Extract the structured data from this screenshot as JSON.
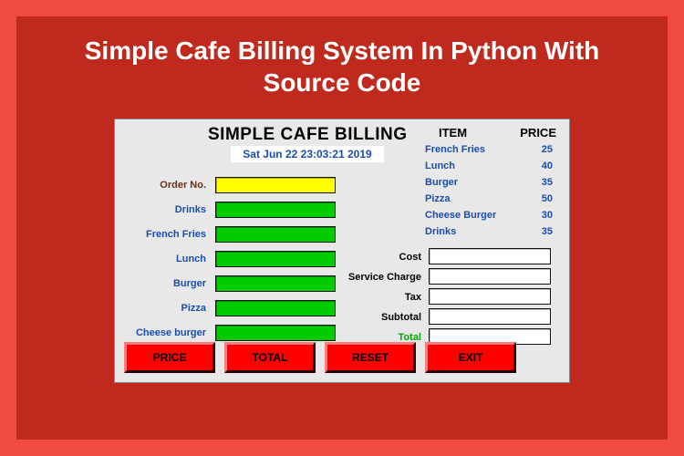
{
  "headline": "Simple Cafe Billing System In Python With Source Code",
  "app": {
    "title": "SIMPLE CAFE BILLING",
    "timestamp": "Sat Jun 22 23:03:21 2019",
    "price_table": {
      "header_item": "ITEM",
      "header_price": "PRICE",
      "rows": [
        {
          "name": "French Fries",
          "price": "25"
        },
        {
          "name": "Lunch",
          "price": "40"
        },
        {
          "name": "Burger",
          "price": "35"
        },
        {
          "name": "Pizza",
          "price": "50"
        },
        {
          "name": "Cheese Burger",
          "price": "30"
        },
        {
          "name": "Drinks",
          "price": "35"
        }
      ]
    },
    "inputs": {
      "order_no_label": "Order No.",
      "drinks_label": "Drinks",
      "french_fries_label": "French Fries",
      "lunch_label": "Lunch",
      "burger_label": "Burger",
      "pizza_label": "Pizza",
      "cheese_burger_label": "Cheese burger"
    },
    "totals": {
      "cost_label": "Cost",
      "service_charge_label": "Service Charge",
      "tax_label": "Tax",
      "subtotal_label": "Subtotal",
      "total_label": "Total"
    },
    "buttons": {
      "price": "PRICE",
      "total": "TOTAL",
      "reset": "RESET",
      "exit": "EXIT"
    }
  }
}
